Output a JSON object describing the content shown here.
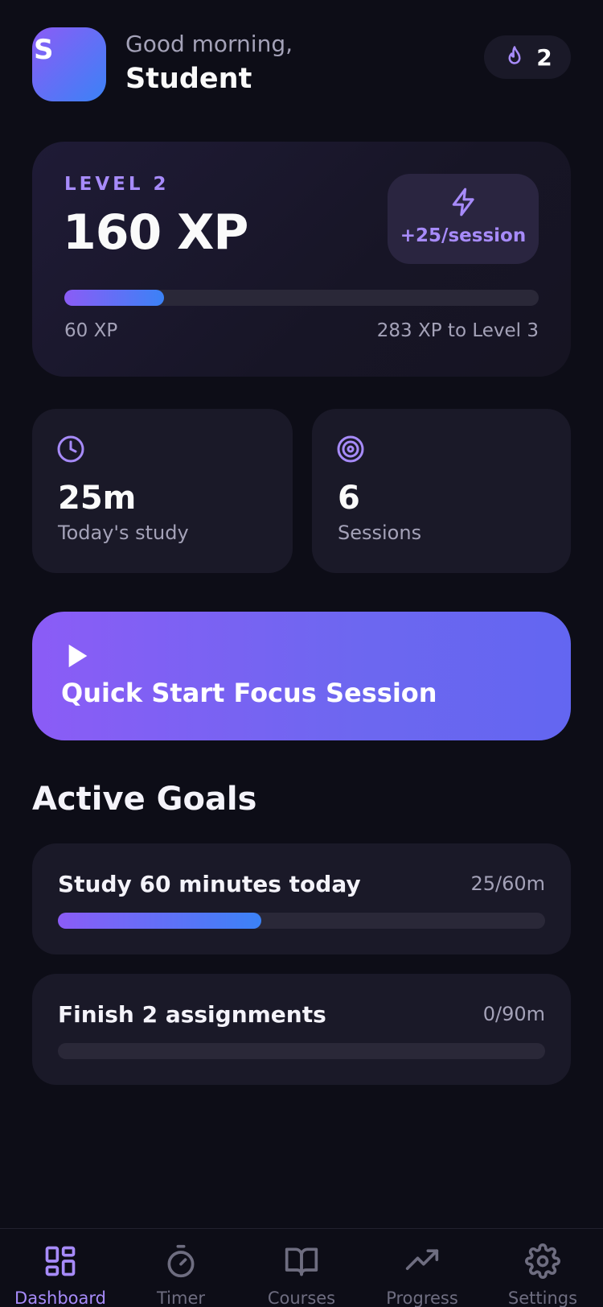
{
  "header": {
    "avatar_letter": "S",
    "greeting": "Good morning,",
    "username": "Student",
    "streak_count": "2",
    "streak_icon": "flame-icon"
  },
  "xp_card": {
    "level_label": "LEVEL 2",
    "total_xp": "160 XP",
    "bonus_icon": "lightning-icon",
    "bonus_text": "+25/session",
    "progress_fraction": 0.21,
    "current_label": "60 XP",
    "to_next_label": "283 XP to Level 3"
  },
  "stats": [
    {
      "icon": "clock-icon",
      "value": "25m",
      "label": "Today's study"
    },
    {
      "icon": "target-icon",
      "value": "6",
      "label": "Sessions"
    }
  ],
  "quick_start": {
    "icon": "play-icon",
    "label": "Quick Start Focus Session"
  },
  "goals_section": {
    "title": "Active Goals",
    "goals": [
      {
        "title": "Study 60 minutes today",
        "progress_text": "25/60m",
        "progress_fraction": 0.4167
      },
      {
        "title": "Finish 2 assignments",
        "progress_text": "0/90m",
        "progress_fraction": 0
      }
    ]
  },
  "bottom_nav": {
    "items": [
      {
        "label": "Dashboard",
        "icon": "dashboard-icon",
        "active": true
      },
      {
        "label": "Timer",
        "icon": "stopwatch-icon",
        "active": false
      },
      {
        "label": "Courses",
        "icon": "book-icon",
        "active": false
      },
      {
        "label": "Progress",
        "icon": "trending-up-icon",
        "active": false
      },
      {
        "label": "Settings",
        "icon": "gear-icon",
        "active": false
      }
    ]
  },
  "colors": {
    "background": "#0d0d17",
    "card": "#1a1928",
    "accent_purple": "#a78bfa",
    "gradient_start": "#8b5cf6",
    "gradient_end": "#3b82f6",
    "muted_text": "#a4a2b8",
    "inactive_nav": "#6e6d80"
  }
}
